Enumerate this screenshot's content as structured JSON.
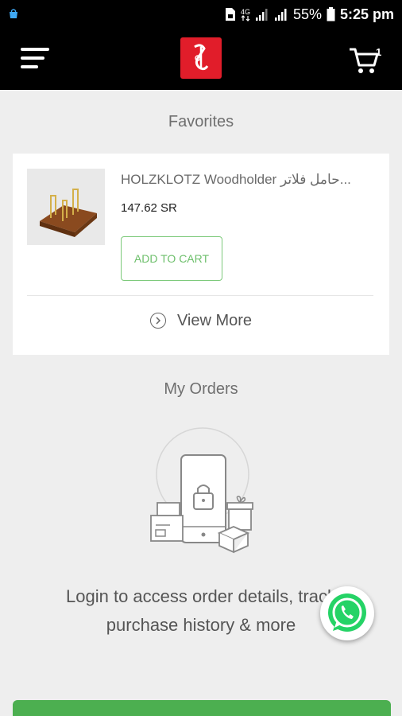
{
  "status_bar": {
    "battery": "55%",
    "time": "5:25 pm",
    "icons": [
      "bag-icon",
      "sim-card-icon",
      "4g-icon",
      "signal-icon",
      "signal-icon",
      "battery-icon"
    ]
  },
  "header": {
    "cart_count": "1",
    "icons": [
      "hamburger-menu-icon",
      "brand-logo",
      "shopping-cart-icon"
    ],
    "logo_color": "#e11d2a"
  },
  "favorites": {
    "title": "Favorites",
    "items": [
      {
        "name": "HOLZKLOTZ Woodholder حامل فلاتر...",
        "price": "147.62 SR",
        "add_to_cart": "ADD TO CART"
      }
    ],
    "view_more": "View More"
  },
  "orders": {
    "title": "My Orders",
    "login_message_line1": "Login to access order details, track",
    "login_message_line2": "purchase history & more"
  },
  "colors": {
    "accent_green": "#4caf50",
    "background": "#eeeeee",
    "bar": "#000000"
  }
}
